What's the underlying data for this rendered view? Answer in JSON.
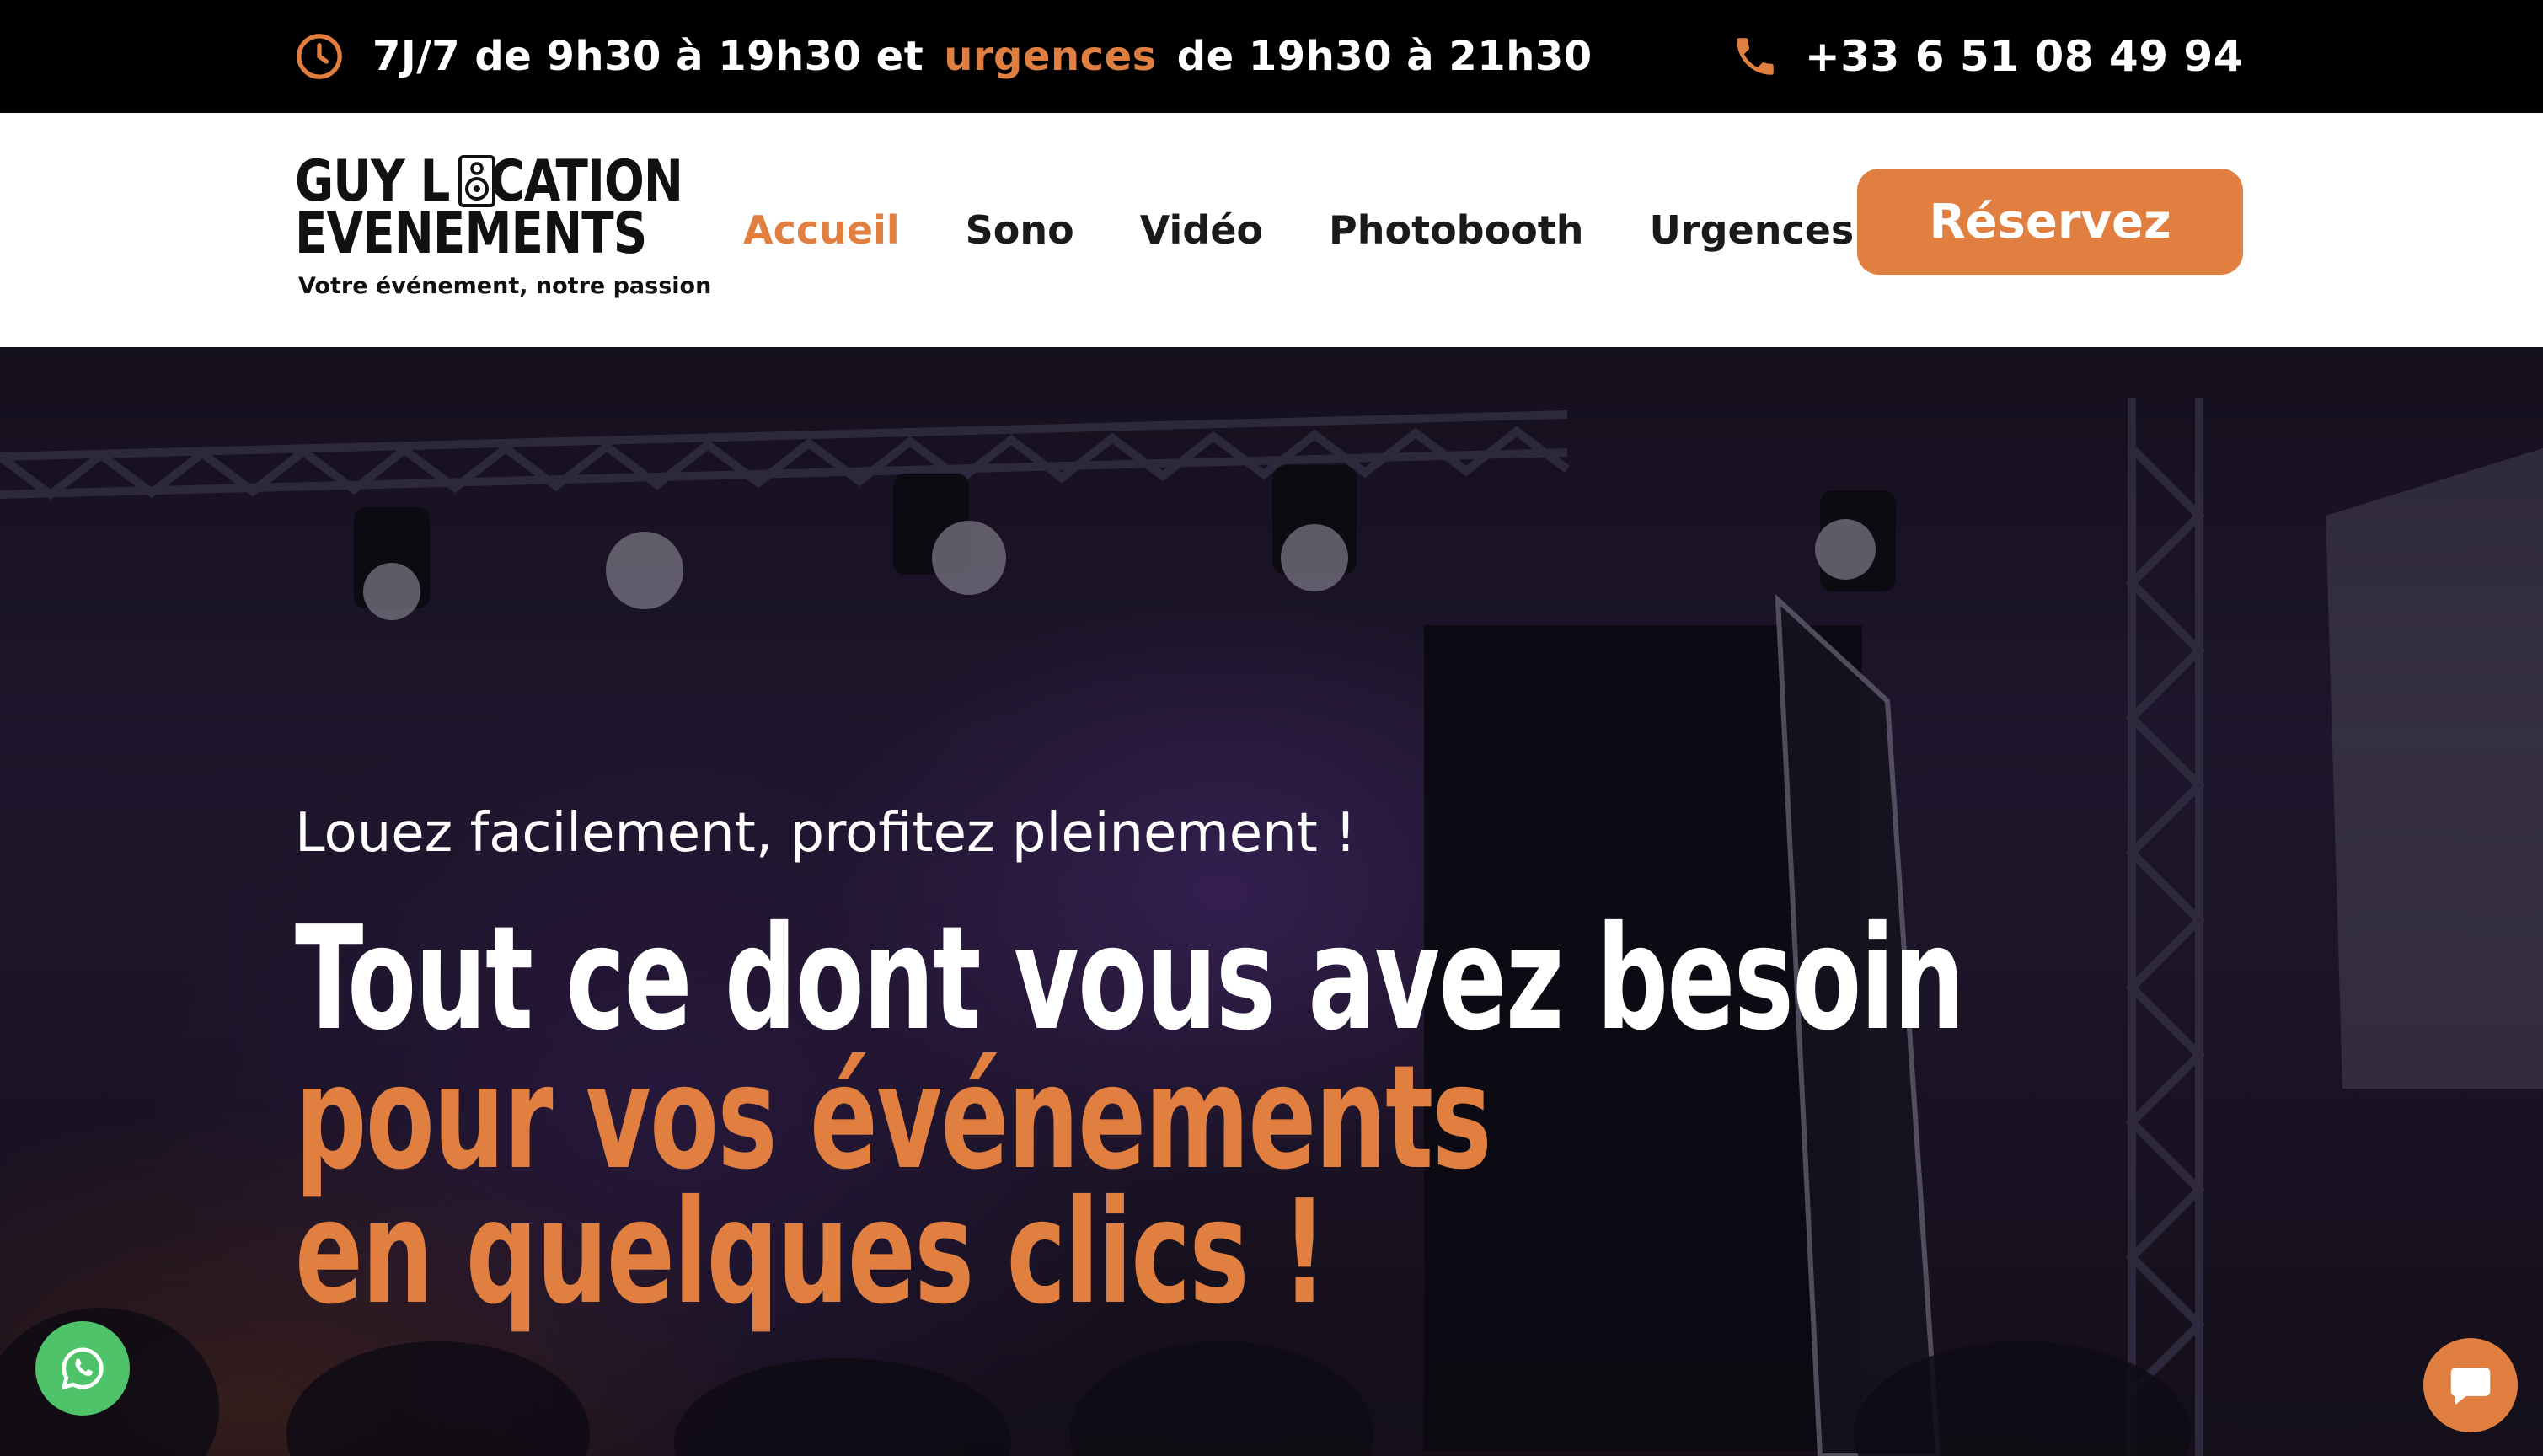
{
  "topbar": {
    "hours_prefix": "7J/7 de 9h30 à 19h30 et",
    "hours_highlight": "urgences",
    "hours_suffix": "de 19h30 à 21h30",
    "phone": "+33 6 51 08 49 94"
  },
  "logo": {
    "line1_a": "GUY L",
    "line1_b": "CATION",
    "line2": "EVENEMENTS",
    "tagline": "Votre événement, notre passion"
  },
  "nav": {
    "items": [
      {
        "label": "Accueil",
        "active": true
      },
      {
        "label": "Sono"
      },
      {
        "label": "Vidéo"
      },
      {
        "label": "Photobooth"
      },
      {
        "label": "Urgences"
      }
    ],
    "cta": "Réservez"
  },
  "hero": {
    "subtitle": "Louez facilement, profitez pleinement !",
    "line1": "Tout ce dont vous avez besoin",
    "line2": "pour vos événements",
    "line3": "en quelques clics !"
  },
  "colors": {
    "accent": "#e07f3f",
    "whatsapp": "#4ec36a",
    "topbar_bg": "#000000"
  },
  "icons": {
    "clock": "clock-icon",
    "phone": "phone-icon",
    "whatsapp": "whatsapp-icon",
    "chat": "chat-bubble-icon",
    "logo_speaker": "speaker-icon"
  }
}
